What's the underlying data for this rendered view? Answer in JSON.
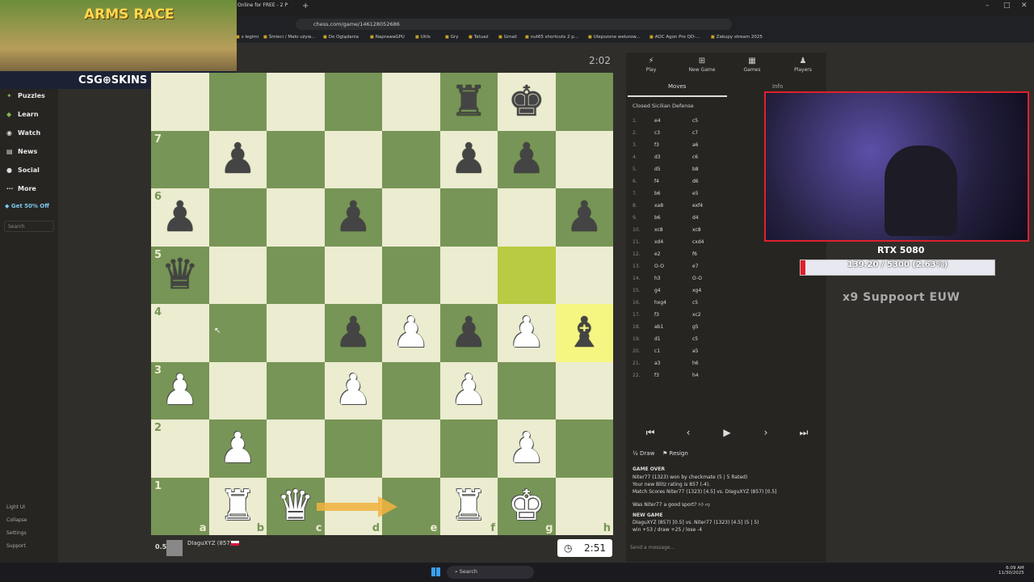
{
  "browser": {
    "tab_title": "Online for FREE - 2 P",
    "url": "chess.com/game/146128052686",
    "bookmarks": [
      "s legimi",
      "Śmieci / Mało używ...",
      "Do Oglądania",
      "NaprawaGPU",
      "Utils",
      "Gry",
      "Tatuaż",
      "Gmail",
      "nut65 shortcuts 2 p...",
      "Ulepszone welurow...",
      "AOC Agon Pro QD-...",
      "Zakupy stream 2025"
    ]
  },
  "overlay_ad": {
    "title": "ARMS RACE",
    "brand": "CSG⊕SKINS"
  },
  "sidebar": {
    "items": [
      {
        "label": "Puzzles",
        "icon": "puzzle-icon"
      },
      {
        "label": "Learn",
        "icon": "learn-icon"
      },
      {
        "label": "Watch",
        "icon": "watch-icon"
      },
      {
        "label": "News",
        "icon": "news-icon"
      },
      {
        "label": "Social",
        "icon": "social-icon"
      },
      {
        "label": "More",
        "icon": "more-icon"
      }
    ],
    "promo": "Get 50% Off",
    "search_placeholder": "Search",
    "bottom": [
      "Light UI",
      "Collapse",
      "Settings",
      "Support"
    ]
  },
  "game": {
    "clock_top": "2:02",
    "clock_bottom": "2:51",
    "eval": "0.5",
    "bottom_player": "DIaguXYZ (857)",
    "ranks": [
      "7",
      "6",
      "5",
      "4",
      "3",
      "2",
      "1"
    ],
    "files": [
      "a",
      "b",
      "c",
      "d",
      "e",
      "f",
      "g",
      "h"
    ]
  },
  "panel": {
    "tabs": [
      "Play",
      "New Game",
      "Games",
      "Players"
    ],
    "subtabs": [
      "Moves",
      "Info"
    ],
    "opening": "Closed Sicilian Defense",
    "moves": [
      [
        "1.",
        "e4",
        "c5"
      ],
      [
        "2.",
        "c3",
        "c7"
      ],
      [
        "3.",
        "f3",
        "a6"
      ],
      [
        "4.",
        "d3",
        "c6"
      ],
      [
        "5.",
        "d5",
        "b8"
      ],
      [
        "6.",
        "f4",
        "d6"
      ],
      [
        "7.",
        "b6",
        "e5"
      ],
      [
        "8.",
        "xa8",
        "exf4"
      ],
      [
        "9.",
        "b6",
        "d4"
      ],
      [
        "10.",
        "xc8",
        "xc8"
      ],
      [
        "11.",
        "xd4",
        "cxd4"
      ],
      [
        "12.",
        "e2",
        "f6"
      ],
      [
        "13.",
        "O-O",
        "e7"
      ],
      [
        "14.",
        "h3",
        "O-O"
      ],
      [
        "15.",
        "g4",
        "xg4"
      ],
      [
        "16.",
        "hxg4",
        "c5"
      ],
      [
        "17.",
        "f3",
        "xc2"
      ],
      [
        "18.",
        "ab1",
        "g5"
      ],
      [
        "19.",
        "d1",
        "c5"
      ],
      [
        "20.",
        "c1",
        "a5"
      ],
      [
        "21.",
        "a3",
        "h6"
      ],
      [
        "22.",
        "f3",
        "h4"
      ]
    ],
    "draw": "Draw",
    "resign": "Resign",
    "game_over": [
      "GAME OVER",
      "Niter77 (1323) won by checkmate (5 | 5 Rated)",
      "Your new Blitz rating is 857 (-4).",
      "Match Scores Niter77 (1323) [4.5] vs. DIaguXYZ (857) [0.5]",
      "Was Niter77 a good sport?",
      "NEW GAME",
      "DIaguXYZ (857) [0.5] vs. Niter77 (1323) [4.5] (5 | 5)",
      "win +53 / draw +25 / lose -4"
    ],
    "message_placeholder": "Send a message..."
  },
  "stream": {
    "gpu_title": "RTX 5080",
    "gpu_usage": "139.20 / 5300 (2.63%)",
    "gpu_fraction": 0.0263,
    "support": "x9 Suppoort   EUW"
  },
  "taskbar": {
    "search": "Search",
    "time": "6:09 AM",
    "date": "11/30/2025"
  }
}
